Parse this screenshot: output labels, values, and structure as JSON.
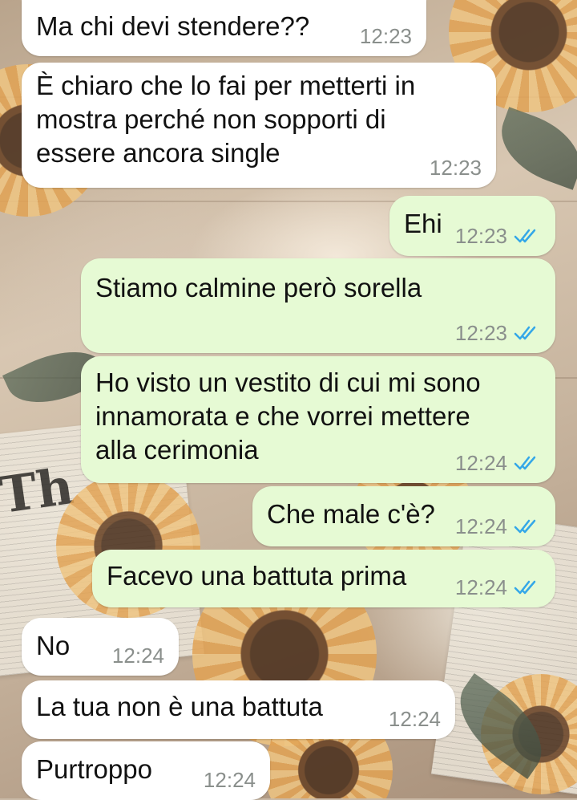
{
  "chat": {
    "messages": [
      {
        "direction": "incoming",
        "text": "Ma chi devi stendere??",
        "time": "12:23"
      },
      {
        "direction": "incoming",
        "text": "È chiaro che lo fai per metterti in mostra perché non sopporti di essere ancora single",
        "lines": [
          "È chiaro che lo fai per metterti in",
          "mostra perché non sopporti di",
          "essere ancora single"
        ],
        "time": "12:23"
      },
      {
        "direction": "outgoing",
        "text": "Ehi",
        "time": "12:23",
        "status": "read"
      },
      {
        "direction": "outgoing",
        "text": "Stiamo calmine però sorella",
        "time": "12:23",
        "status": "read"
      },
      {
        "direction": "outgoing",
        "text": "Ho visto un vestito di cui mi sono innamorata e che vorrei mettere alla cerimonia",
        "lines": [
          "Ho visto un vestito di cui mi sono",
          "innamorata e che vorrei mettere",
          "alla cerimonia"
        ],
        "time": "12:24",
        "status": "read"
      },
      {
        "direction": "outgoing",
        "text": "Che male c'è?",
        "time": "12:24",
        "status": "read"
      },
      {
        "direction": "outgoing",
        "text": "Facevo una battuta prima",
        "time": "12:24",
        "status": "read"
      },
      {
        "direction": "incoming",
        "text": "No",
        "time": "12:24"
      },
      {
        "direction": "incoming",
        "text": "La tua non è una battuta",
        "time": "12:24"
      },
      {
        "direction": "incoming",
        "text": "Purtroppo",
        "time": "12:24"
      }
    ]
  },
  "colors": {
    "incoming_bubble": "#ffffff",
    "outgoing_bubble": "#e6fad4",
    "timestamp": "#8a8f8c",
    "read_ticks": "#34a7e8"
  },
  "icons": {
    "read_status": "double-check-icon"
  }
}
